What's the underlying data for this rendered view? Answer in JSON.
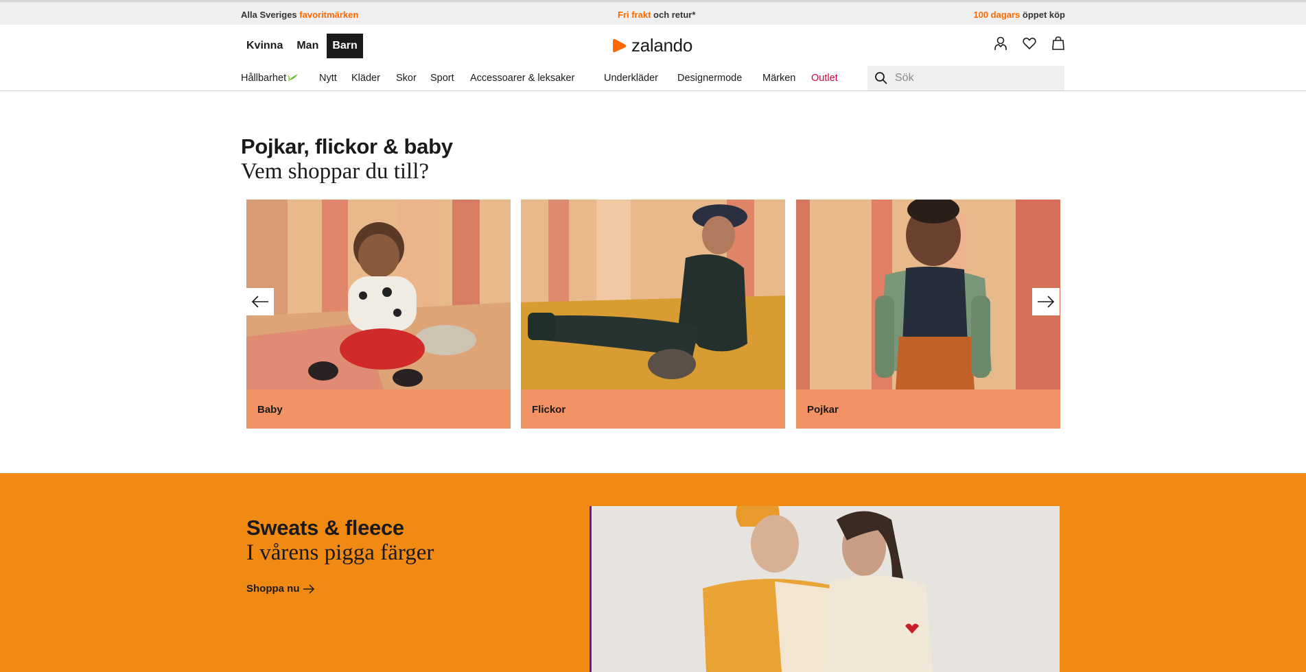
{
  "promo": {
    "left_prefix": "Alla Sveriges ",
    "left_highlight": "favoritmärken",
    "mid_highlight": "Fri frakt",
    "mid_suffix": " och retur*",
    "right_highlight": "100 dagars",
    "right_suffix": " öppet köp"
  },
  "header": {
    "gender_tabs": [
      "Kvinna",
      "Man",
      "Barn"
    ],
    "active_gender": "Barn",
    "logo_text": "zalando",
    "icons": [
      "account-icon",
      "heart-icon",
      "bag-icon"
    ]
  },
  "catnav": {
    "items": [
      "Hållbarhet",
      "Nytt",
      "Kläder",
      "Skor",
      "Sport",
      "Accessoarer & leksaker",
      "Underkläder",
      "Designermode",
      "Märken",
      "Outlet"
    ]
  },
  "search": {
    "placeholder": "Sök"
  },
  "hero": {
    "title": "Pojkar, flickor & baby",
    "subtitle": "Vem shoppar du till?",
    "cards": [
      {
        "label": "Baby"
      },
      {
        "label": "Flickor"
      },
      {
        "label": "Pojkar"
      }
    ]
  },
  "promo_block": {
    "title": "Sweats & fleece",
    "subtitle": "I vårens pigga färger",
    "cta": "Shoppa nu"
  },
  "colors": {
    "brand_orange": "#ff6900",
    "card_label_bg": "#f39264",
    "section_bg": "#f08a12",
    "outlet_red": "#d6003a",
    "promo_bar_bg": "#efeff0"
  }
}
